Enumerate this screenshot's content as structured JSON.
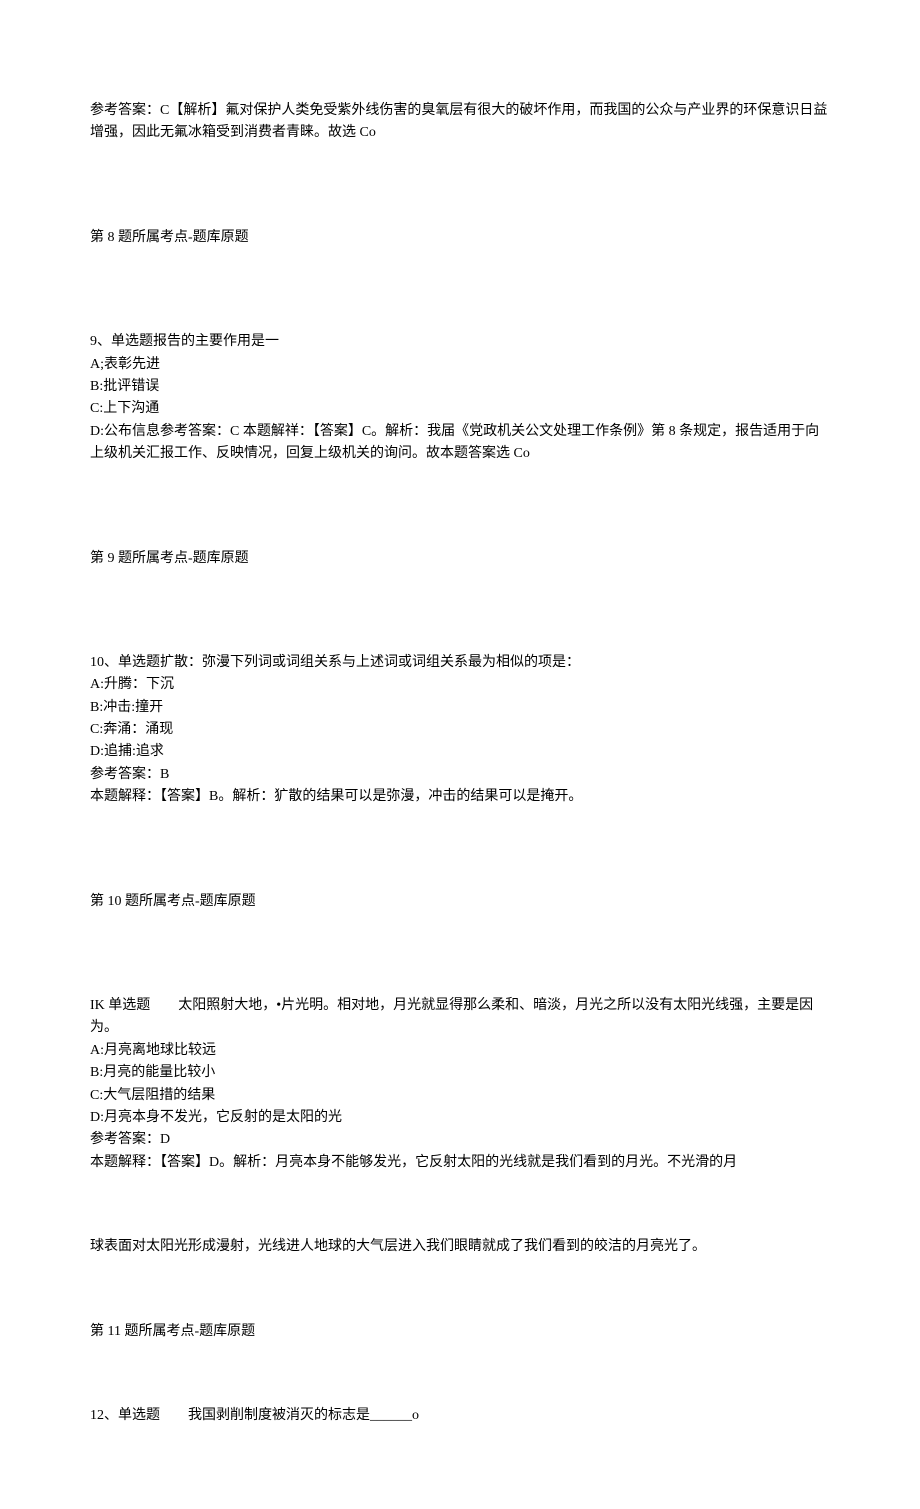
{
  "q8_answer": {
    "text": "参考答案：C【解析】氟对保护人类免受紫外线伤害的臭氧层有很大的破坏作用，而我国的公众与产业界的环保意识日益增强，因此无氟冰箱受到消费者青睐。故选 Co"
  },
  "q8_tag": "第 8 题所属考点-题库原题",
  "q9": {
    "stem": "9、单选题报告的主要作用是一",
    "optA": "A;表彰先进",
    "optB": "B:批评错误",
    "optC": "C:上下沟通",
    "optD_full": "D:公布信息参考答案：C 本题解祥：【答案】C。解析：我届《党政机关公文处理工作条例》第 8 条规定，报告适用于向上级机关汇报工作、反映情况，回复上级机关的询问。故本题答案选 Co"
  },
  "q9_tag": "第 9 题所属考点-题库原题",
  "q10": {
    "stem": "10、单选题扩散：弥漫下列词或词组关系与上述词或词组关系最为相似的项是：",
    "optA": "A:升腾：下沉",
    "optB": "B:冲击:撞开",
    "optC": "C:奔涌：涌现",
    "optD": "D:追捕:追求",
    "ans": "参考答案：B",
    "explain": "本题解释：【答案】B。解析：犷散的结果可以是弥漫，冲击的结果可以是掩开。"
  },
  "q10_tag": "第 10 题所属考点-题库原题",
  "q11": {
    "stem": "IK 单选题  太阳照射大地，•片光明。相对地，月光就显得那么柔和、暗淡，月光之所以没有太阳光线强，主要是因为。",
    "optA": "A:月亮离地球比较远",
    "optB": "B:月亮的能量比较小",
    "optC": "C:大气层阻措的结果",
    "optD": "D:月亮本身不发光，它反射的是太阳的光",
    "ans": "参考答案：D",
    "explain1": "本题解释：【答案】D。解析：月亮本身不能够发光，它反射太阳的光线就是我们看到的月光。不光滑的月",
    "explain2": "球表面对太阳光形成漫射，光线进人地球的大气层进入我们眼睛就成了我们看到的皎洁的月亮光了。"
  },
  "q11_tag": "第 11 题所属考点-题库原题",
  "q12": {
    "stem": "12、单选题  我国剥削制度被消灭的标志是______o"
  }
}
